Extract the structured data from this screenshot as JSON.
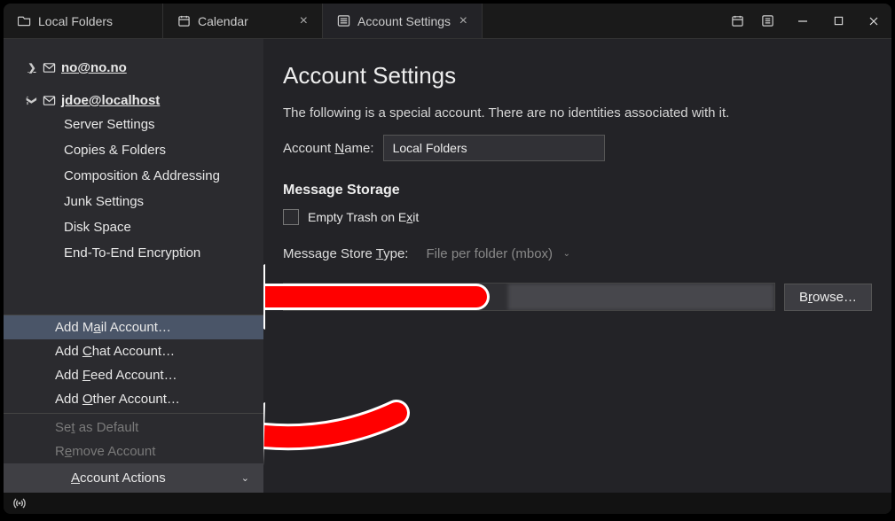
{
  "tabs": {
    "t0": "Local Folders",
    "t1": "Calendar",
    "t2": "Account Settings"
  },
  "sidebar": {
    "acct0": "no@no.no",
    "acct1": "jdoe@localhost",
    "sub": {
      "s0": "Server Settings",
      "s1": "Copies & Folders",
      "s2": "Composition & Addressing",
      "s3": "Junk Settings",
      "s4": "Disk Space",
      "s5": "End-To-End Encryption"
    }
  },
  "ctx": {
    "addMail_pre": "Add M",
    "addMail_u": "a",
    "addMail_post": "il Account…",
    "addChat_pre": "Add ",
    "addChat_u": "C",
    "addChat_post": "hat Account…",
    "addFeed_pre": "Add ",
    "addFeed_u": "F",
    "addFeed_post": "eed Account…",
    "addOther_pre": "Add ",
    "addOther_u": "O",
    "addOther_post": "ther Account…",
    "setDef_pre": "Se",
    "setDef_u": "t",
    "setDef_post": " as Default",
    "remove_pre": "R",
    "remove_u": "e",
    "remove_post": "move Account",
    "actions_pre": "",
    "actions_u": "A",
    "actions_post": "ccount Actions"
  },
  "main": {
    "title": "Account Settings",
    "desc": "The following is a special account. There are no identities associated with it.",
    "accountNameLabel_pre": "Account ",
    "accountNameLabel_u": "N",
    "accountNameLabel_post": "ame:",
    "accountNameValue": "Local Folders",
    "storageHeader": "Message Storage",
    "emptyTrash_pre": "Empty Trash on E",
    "emptyTrash_u": "x",
    "emptyTrash_post": "it",
    "storeTypeLabel_pre": "Message Store ",
    "storeTypeLabel_u": "T",
    "storeTypeLabel_post": "ype:",
    "storeTypeValue": "File per folder (mbox)",
    "browse_pre": "B",
    "browse_u": "r",
    "browse_post": "owse…"
  }
}
